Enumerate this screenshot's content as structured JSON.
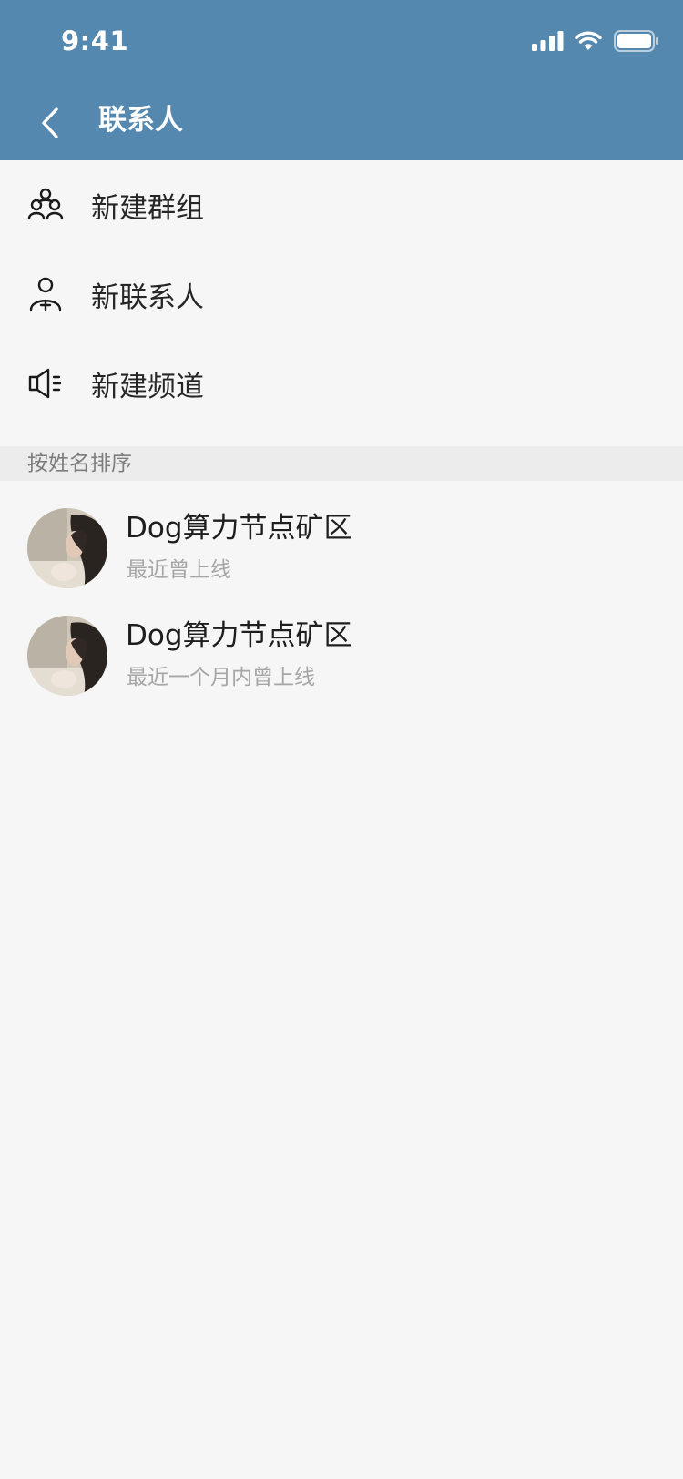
{
  "status_bar": {
    "time": "9:41",
    "icons": [
      "signal-icon",
      "wifi-icon",
      "battery-icon"
    ]
  },
  "header": {
    "back_icon": "back-arrow-icon",
    "title": "联系人",
    "background_color": "#5588ae"
  },
  "actions": [
    {
      "icon": "group-icon",
      "label": "新建群组"
    },
    {
      "icon": "add-contact-icon",
      "label": "新联系人"
    },
    {
      "icon": "megaphone-icon",
      "label": "新建频道"
    }
  ],
  "section": {
    "label": "按姓名排序"
  },
  "contacts": [
    {
      "name": "Dog算力节点矿区",
      "status": "最近曾上线",
      "avatar": "photo-avatar"
    },
    {
      "name": "Dog算力节点矿区",
      "status": "最近一个月内曾上线",
      "avatar": "photo-avatar"
    }
  ]
}
